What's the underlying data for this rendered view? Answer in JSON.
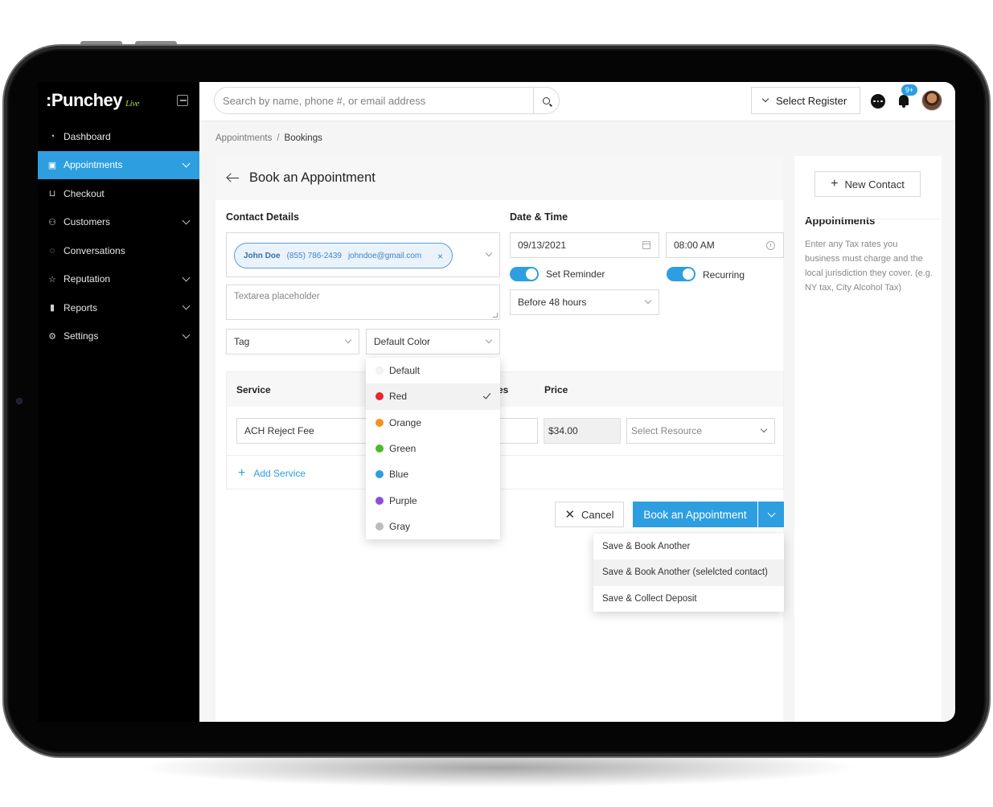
{
  "app": {
    "logo": ":Punchey",
    "logo_tag": "Live"
  },
  "sidebar": {
    "items": [
      {
        "label": "Dashboard",
        "icon": "dashboard-icon"
      },
      {
        "label": "Appointments",
        "icon": "calendar-icon",
        "active": true
      },
      {
        "label": "Checkout",
        "icon": "cart-icon"
      },
      {
        "label": "Customers",
        "icon": "users-icon"
      },
      {
        "label": "Conversations",
        "icon": "chat-icon"
      },
      {
        "label": "Reputation",
        "icon": "star-icon"
      },
      {
        "label": "Reports",
        "icon": "bar-chart-icon"
      },
      {
        "label": "Settings",
        "icon": "gear-icon"
      }
    ]
  },
  "topbar": {
    "search_placeholder": "Search by name, phone #, or email address",
    "register_label": "Select Register",
    "notification_badge": "9+"
  },
  "breadcrumb": {
    "parent": "Appointments",
    "separator": "/",
    "current": "Bookings"
  },
  "form": {
    "title": "Book an Appointment",
    "contact_details_title": "Contact Details",
    "contact": {
      "name": "John Doe",
      "phone": "(855) 786-2439",
      "email": "johndoe@gmail.com",
      "remove": "×"
    },
    "textarea_placeholder": "Textarea placeholder",
    "tag_placeholder": "Tag",
    "color_value": "Default Color",
    "date_time_title": "Date & Time",
    "date": "09/13/2021",
    "time": "08:00 AM",
    "set_reminder_label": "Set Reminder",
    "set_reminder_on": true,
    "recurring_label": "Recurring",
    "recurring_on": true,
    "reminder_option": "Before 48 hours",
    "service_header": "Service",
    "hidden_header_fragment": "es",
    "price_header": "Price",
    "service_value": "ACH Reject Fee",
    "price_value": "$34.00",
    "resource_placeholder": "Select Resource",
    "add_service": "Add Service",
    "cancel": "Cancel",
    "book": "Book an Appointment"
  },
  "color_menu": {
    "selected": "Red",
    "options": [
      {
        "label": "Default",
        "color": "#f3f3f3"
      },
      {
        "label": "Red",
        "color": "#e8262d"
      },
      {
        "label": "Orange",
        "color": "#f7921e"
      },
      {
        "label": "Green",
        "color": "#4cba2b"
      },
      {
        "label": "Blue",
        "color": "#2d9ee0"
      },
      {
        "label": "Purple",
        "color": "#8a4fde"
      },
      {
        "label": "Gray",
        "color": "#bdbdbd"
      }
    ]
  },
  "save_menu": {
    "items": [
      "Save & Book Another",
      "Save & Book Another (selelcted contact)",
      "Save & Collect Deposit"
    ]
  },
  "right_panel": {
    "new_contact": "New Contact",
    "title": "Appointments",
    "text": "Enter any Tax rates you business must charge and the local jurisdiction they cover. (e.g. NY tax, City Alcohol Tax)"
  },
  "colors": {
    "accent": "#2d9ee0",
    "sidebar_bg": "#000000"
  }
}
